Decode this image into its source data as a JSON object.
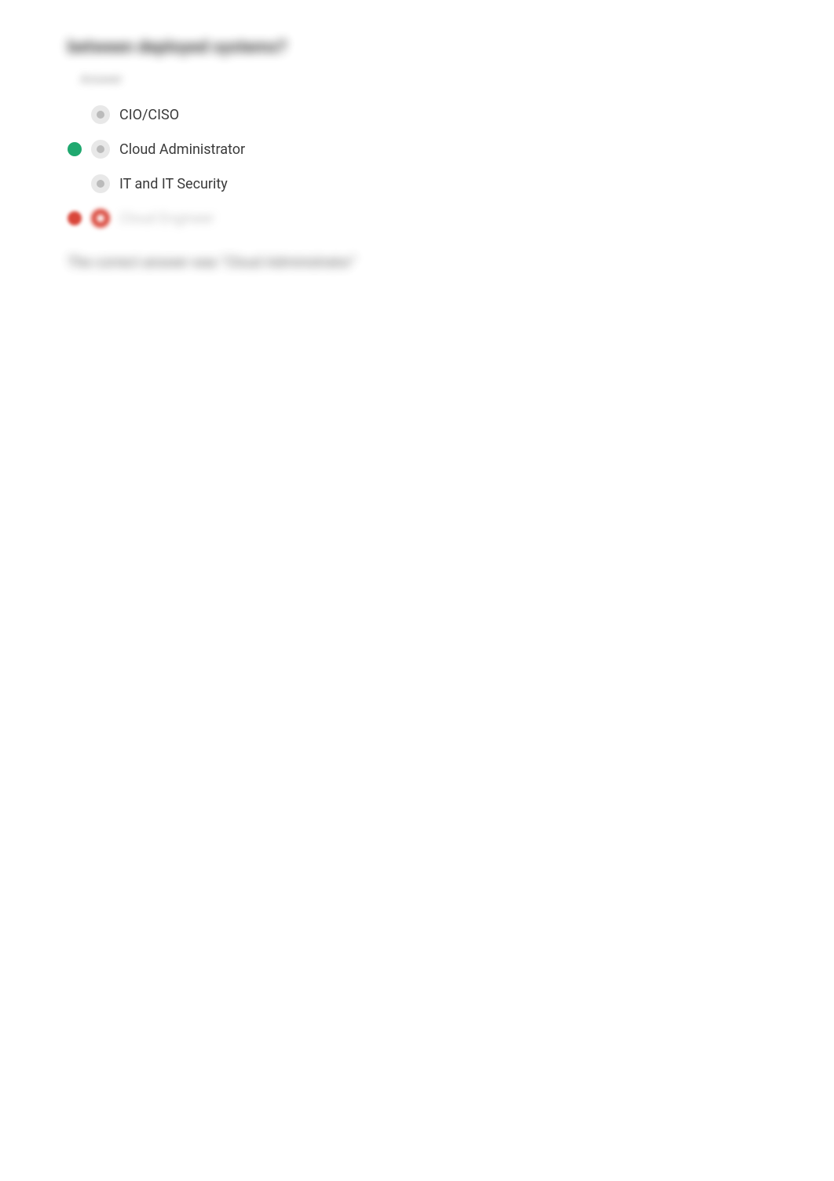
{
  "question": {
    "title": "between deployed systems?",
    "answer_label": "Answer"
  },
  "options": [
    {
      "label": "CIO/CISO",
      "marker": "none",
      "selected": false,
      "blurred": false
    },
    {
      "label": "Cloud Administrator",
      "marker": "green",
      "selected": false,
      "blurred": false
    },
    {
      "label": "IT and IT Security",
      "marker": "none",
      "selected": false,
      "blurred": false
    },
    {
      "label": "Cloud Engineer",
      "marker": "red",
      "selected": true,
      "blurred": true
    }
  ],
  "feedback": "The correct answer was \"Cloud Administrator\""
}
